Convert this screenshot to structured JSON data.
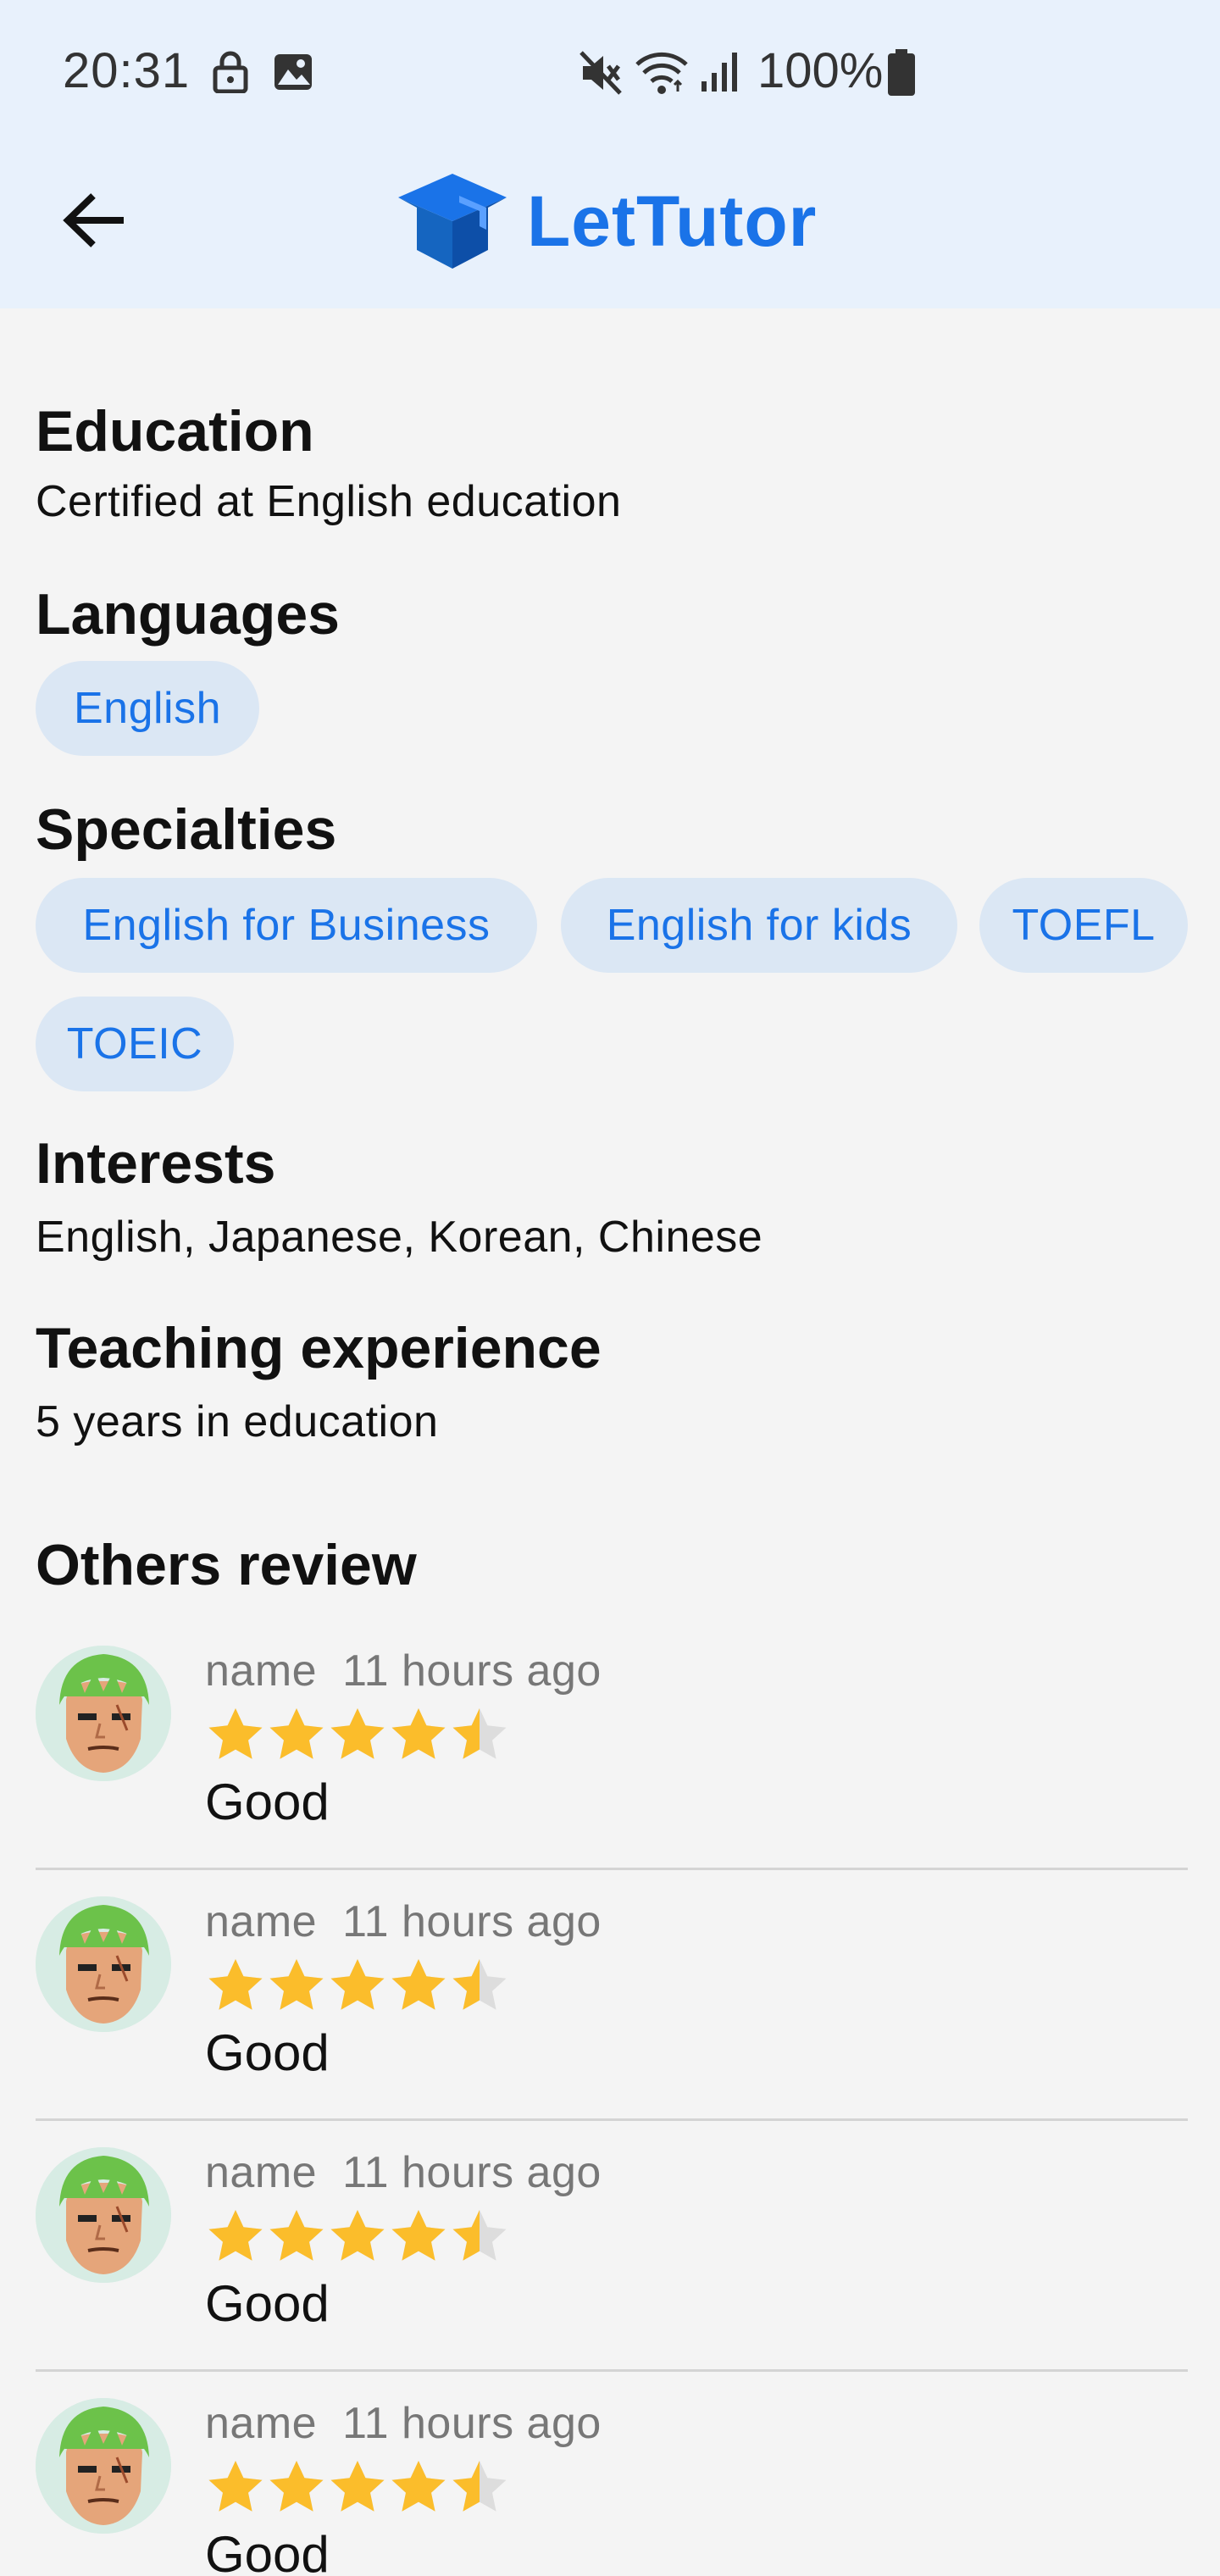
{
  "status_bar": {
    "time": "20:31",
    "battery": "100%",
    "icons": [
      "lock-icon",
      "image-icon",
      "mute-icon",
      "wifi-icon",
      "signal-icon",
      "battery-icon"
    ]
  },
  "app_bar": {
    "back_icon": "arrow-left-icon",
    "logo_icon": "graduation-cap-icon",
    "logo_text": "LetTutor"
  },
  "colors": {
    "brand": "#1a73e8",
    "header_bg": "#e8f1fc",
    "chip_bg": "#dbe7f4",
    "star": "#fbbd2b",
    "star_empty": "#dddddd"
  },
  "sections": {
    "education": {
      "title": "Education",
      "text": "Certified at English education"
    },
    "languages": {
      "title": "Languages",
      "items": [
        "English"
      ]
    },
    "specialties": {
      "title": "Specialties",
      "items": [
        "English for Business",
        "English for kids",
        "TOEFL",
        "TOEIC"
      ]
    },
    "interests": {
      "title": "Interests",
      "text": "English, Japanese, Korean, Chinese"
    },
    "experience": {
      "title": "Teaching experience",
      "text": "5 years in education"
    },
    "reviews": {
      "title": "Others review",
      "items": [
        {
          "name": "name",
          "time": "11 hours ago",
          "rating": 4.5,
          "comment": "Good"
        },
        {
          "name": "name",
          "time": "11 hours ago",
          "rating": 4.5,
          "comment": "Good"
        },
        {
          "name": "name",
          "time": "11 hours ago",
          "rating": 4.5,
          "comment": "Good"
        },
        {
          "name": "name",
          "time": "11 hours ago",
          "rating": 4.5,
          "comment": "Good"
        }
      ]
    }
  }
}
